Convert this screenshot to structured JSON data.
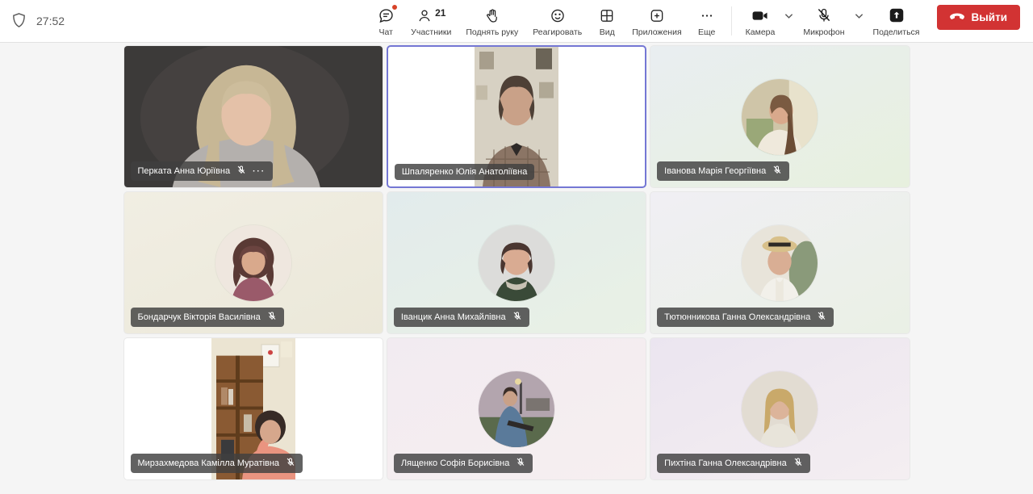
{
  "colors": {
    "leave_button": "#d23333",
    "badge": "#d74228",
    "selected_border": "#7477d4",
    "label_bg": "rgba(64,64,64,0.82)",
    "toolbar_bg": "#ffffff",
    "stage_bg": "#f5f5f5"
  },
  "toolbar": {
    "timer": "27:52",
    "chat": {
      "label": "Чат",
      "has_notification": true
    },
    "participants": {
      "label": "Участники",
      "count": "21"
    },
    "raise_hand": {
      "label": "Поднять руку"
    },
    "react": {
      "label": "Реагировать"
    },
    "view": {
      "label": "Вид"
    },
    "apps": {
      "label": "Приложения"
    },
    "more": {
      "label": "Еще"
    },
    "camera": {
      "label": "Камера",
      "on": true
    },
    "mic": {
      "label": "Микрофон",
      "muted": true
    },
    "share": {
      "label": "Поделиться"
    },
    "leave": {
      "label": "Выйти"
    }
  },
  "participants": [
    {
      "name": "Перката Анна Юріївна",
      "muted": true,
      "more": true,
      "type": "video-full",
      "selected": false
    },
    {
      "name": "Шпаляренко Юлія Анатоліївна",
      "muted": false,
      "more": false,
      "type": "video-portrait",
      "selected": true
    },
    {
      "name": "Іванова Марія Георгіївна",
      "muted": true,
      "more": false,
      "type": "avatar",
      "bg": [
        "#e9eef1",
        "#e7f0de"
      ]
    },
    {
      "name": "Бондарчук Вікторія Василівна",
      "muted": true,
      "more": false,
      "type": "avatar",
      "bg": [
        "#f1eee3",
        "#ebe8d9"
      ]
    },
    {
      "name": "Іванцик Анна Михайлівна",
      "muted": true,
      "more": false,
      "type": "avatar",
      "bg": [
        "#e2ebec",
        "#e9f1e5"
      ]
    },
    {
      "name": "Тютюнникова Ганна Олександрівна",
      "muted": true,
      "more": false,
      "type": "avatar",
      "bg": [
        "#f0eff4",
        "#eaf0e5"
      ]
    },
    {
      "name": "Мирзахмедова Камілла Муратівна",
      "muted": true,
      "more": false,
      "type": "video-portrait",
      "selected": false
    },
    {
      "name": "Лященко Софія Борисівна",
      "muted": true,
      "more": false,
      "type": "avatar",
      "bg": [
        "#f2ebf1",
        "#f6eff0"
      ]
    },
    {
      "name": "Пихтіна Ганна Олександрівна",
      "muted": true,
      "more": false,
      "type": "avatar",
      "bg": [
        "#ebe5f0",
        "#f4eef1"
      ]
    }
  ]
}
